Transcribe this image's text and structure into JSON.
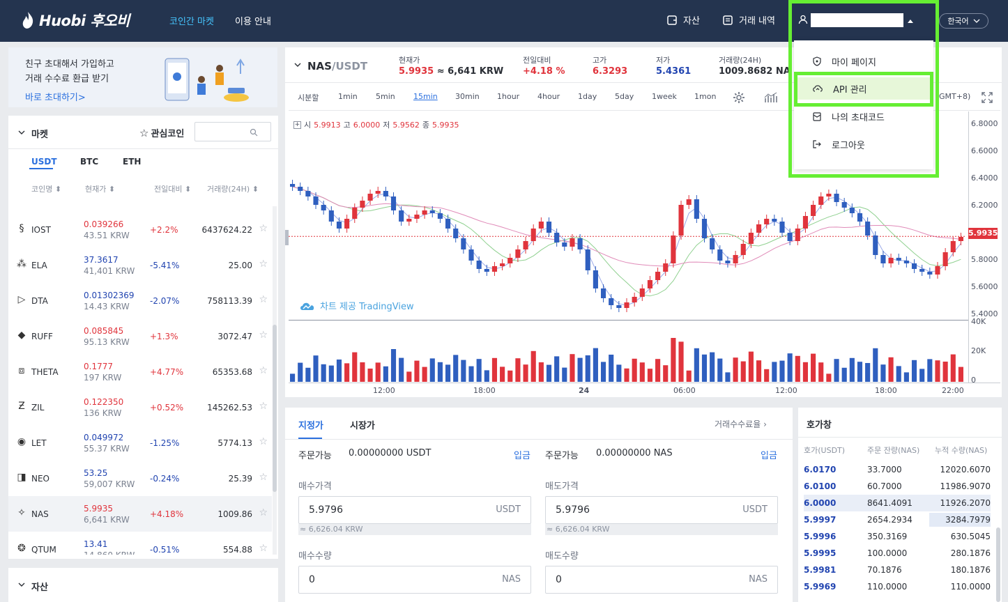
{
  "topbar": {
    "logo": "Huobi 후오비",
    "nav": [
      "코인간 마켓",
      "이용 안내"
    ],
    "assets": "자산",
    "history": "거래 내역",
    "lang": "한국어"
  },
  "dropdown": {
    "items": [
      "마이 페이지",
      "API 관리",
      "나의 초대코드",
      "로그아웃"
    ]
  },
  "promo": {
    "line1": "친구 초대해서 가입하고",
    "line2": "거래 수수료 환급 받기",
    "link": "바로 초대하기>"
  },
  "market": {
    "title": "마켓",
    "favorites": "관심코인",
    "tabs": [
      "USDT",
      "BTC",
      "ETH"
    ],
    "columns": [
      "코인명",
      "현재가",
      "전일대비",
      "거래량(24H)"
    ],
    "rows": [
      {
        "name": "IOST",
        "price": "0.039266",
        "krw": "43.51 KRW",
        "change": "+2.2%",
        "vol": "6437624.22",
        "up": true
      },
      {
        "name": "ELA",
        "price": "37.3617",
        "krw": "41,401 KRW",
        "change": "-5.41%",
        "vol": "25.00",
        "up": false
      },
      {
        "name": "DTA",
        "price": "0.01302369",
        "krw": "14.43 KRW",
        "change": "-2.07%",
        "vol": "758113.39",
        "up": false
      },
      {
        "name": "RUFF",
        "price": "0.085845",
        "krw": "95.13 KRW",
        "change": "+1.3%",
        "vol": "3072.47",
        "up": true
      },
      {
        "name": "THETA",
        "price": "0.1777",
        "krw": "197 KRW",
        "change": "+4.77%",
        "vol": "65353.68",
        "up": true
      },
      {
        "name": "ZIL",
        "price": "0.122350",
        "krw": "136 KRW",
        "change": "+0.52%",
        "vol": "145262.53",
        "up": true
      },
      {
        "name": "LET",
        "price": "0.049972",
        "krw": "55.37 KRW",
        "change": "-1.25%",
        "vol": "5774.13",
        "up": false
      },
      {
        "name": "NEO",
        "price": "53.25",
        "krw": "59,007 KRW",
        "change": "-0.24%",
        "vol": "25.39",
        "up": false
      },
      {
        "name": "NAS",
        "price": "5.9935",
        "krw": "6,641 KRW",
        "change": "+4.18%",
        "vol": "1009.86",
        "up": true
      },
      {
        "name": "QTUM",
        "price": "13.41",
        "krw": "14,860 KRW",
        "change": "-0.51%",
        "vol": "554.88",
        "up": false
      }
    ]
  },
  "assets_panel": {
    "title": "자산"
  },
  "ticker": {
    "pair_base": "NAS",
    "pair_quote": "/USDT",
    "labels": [
      "현재가",
      "전일대비",
      "고가",
      "저가",
      "거래량(24H)"
    ],
    "price": "5.9935",
    "price_krw": "≈ 6,641 KRW",
    "change": "+4.18 %",
    "high": "6.3293",
    "low": "5.4361",
    "volume": "1009.8682 NAS"
  },
  "chart_toolbar": {
    "timeframes": [
      "시분할",
      "1min",
      "5min",
      "15min",
      "30min",
      "1hour",
      "4hour",
      "1day",
      "5day",
      "1week",
      "1mon"
    ],
    "active": "15min",
    "tz": "GMT+8)"
  },
  "chart_data": {
    "type": "line",
    "ohlc_legend": {
      "o_label": "시",
      "o": "5.9913",
      "h_label": "고",
      "h": "6.0000",
      "l_label": "저",
      "l": "5.9562",
      "c_label": "종",
      "c": "5.9935"
    },
    "last_price": "5.9935",
    "y_ticks": [
      "6.8000",
      "6.6000",
      "6.4000",
      "6.2000",
      "6.0000",
      "5.8000",
      "5.6000",
      "5.4000"
    ],
    "ylim": [
      5.4,
      6.8
    ],
    "vol_ticks": [
      "40K",
      "20K",
      "0"
    ],
    "x_ticks": [
      "12:00",
      "18:00",
      "24",
      "06:00",
      "12:00",
      "18:00",
      "22:00"
    ],
    "watermark": "차트 제공 TradingView",
    "close": [
      6.35,
      6.32,
      6.28,
      6.22,
      6.18,
      6.1,
      6.05,
      6.12,
      6.2,
      6.25,
      6.3,
      6.32,
      6.28,
      6.18,
      6.1,
      6.12,
      6.15,
      6.18,
      6.16,
      6.12,
      6.05,
      5.98,
      5.9,
      5.82,
      5.76,
      5.74,
      5.78,
      5.8,
      5.84,
      5.9,
      5.96,
      6.05,
      6.1,
      6.02,
      5.95,
      5.92,
      5.98,
      5.9,
      5.75,
      5.62,
      5.55,
      5.5,
      5.48,
      5.52,
      5.56,
      5.62,
      5.68,
      5.74,
      5.8,
      6.0,
      6.22,
      6.26,
      6.12,
      5.98,
      5.9,
      5.82,
      5.8,
      5.86,
      5.94,
      6.02,
      6.08,
      6.12,
      6.1,
      6.02,
      5.96,
      6.05,
      6.14,
      6.22,
      6.28,
      6.3,
      6.24,
      6.2,
      6.16,
      6.1,
      6.0,
      5.86,
      5.8,
      5.84,
      5.82,
      5.8,
      5.76,
      5.74,
      5.72,
      5.78,
      5.88,
      5.96,
      5.99
    ]
  },
  "order": {
    "tab_limit": "지정가",
    "tab_market": "시장가",
    "fee": "거래수수료율",
    "avail": "주문가능",
    "buy_avail": "0.00000000 USDT",
    "sell_avail": "0.00000000 NAS",
    "deposit": "입금",
    "buy_price_label": "매수가격",
    "sell_price_label": "매도가격",
    "buy_price": "5.9796",
    "sell_price": "5.9796",
    "quote_unit": "USDT",
    "base_unit": "NAS",
    "krw_note": "≈ 6,626.04 KRW",
    "buy_qty_label": "매수수량",
    "sell_qty_label": "매도수량",
    "qty": "0"
  },
  "book": {
    "title": "호가창",
    "columns": [
      "호가(USDT)",
      "주문 잔량(NAS)",
      "누적 수량(NAS)"
    ],
    "rows": [
      {
        "p": "6.0170",
        "q": "33.7000",
        "c": "12020.6070"
      },
      {
        "p": "6.0100",
        "q": "60.7000",
        "c": "11986.9070"
      },
      {
        "p": "6.0000",
        "q": "8641.4091",
        "c": "11926.2070"
      },
      {
        "p": "5.9997",
        "q": "2654.2934",
        "c": "3284.7979"
      },
      {
        "p": "5.9996",
        "q": "350.3169",
        "c": "630.5045"
      },
      {
        "p": "5.9995",
        "q": "100.0000",
        "c": "280.1876"
      },
      {
        "p": "5.9981",
        "q": "70.1876",
        "c": "180.1876"
      },
      {
        "p": "5.9969",
        "q": "110.0000",
        "c": "110.0000"
      }
    ]
  },
  "colors": {
    "up": "#e0343c",
    "down": "#2f5fbf",
    "accent": "#2a6fde",
    "highlight": "#66ee33",
    "topbar": "#24344f"
  }
}
